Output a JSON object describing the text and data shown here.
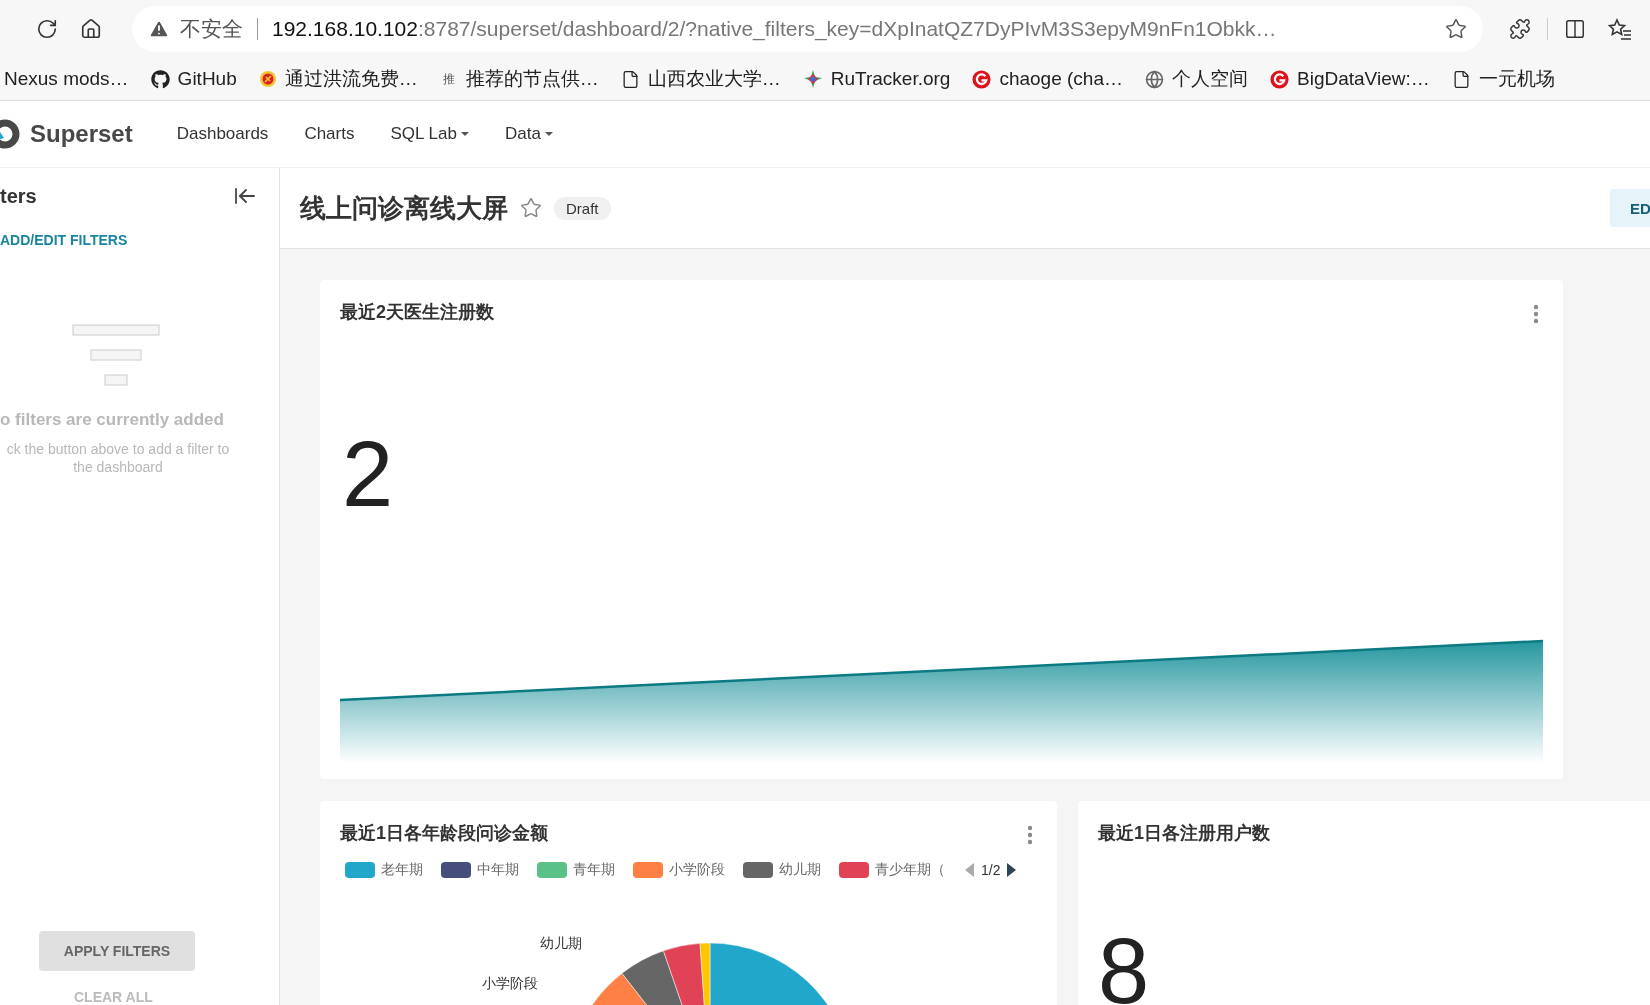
{
  "browser": {
    "security_label": "不安全",
    "url_host": "192.168.10.102",
    "url_rest": ":8787/superset/dashboard/2/?native_filters_key=dXpInatQZ7DyPIvM3S3epyM9nFn1Obkk…"
  },
  "bookmarks": [
    {
      "label": "Nexus mods…",
      "kind": "none"
    },
    {
      "label": "GitHub",
      "kind": "github"
    },
    {
      "label": "通过洪流免费…",
      "kind": "emblem"
    },
    {
      "label": "推荐的节点供…",
      "kind": "text",
      "icon_text": "推"
    },
    {
      "label": "山西农业大学…",
      "kind": "page"
    },
    {
      "label": "RuTracker.org",
      "kind": "stars"
    },
    {
      "label": "chaoge (cha…",
      "kind": "brand"
    },
    {
      "label": "个人空间",
      "kind": "globe"
    },
    {
      "label": "BigDataView:…",
      "kind": "brand"
    },
    {
      "label": "一元机场",
      "kind": "page"
    }
  ],
  "navbar": {
    "brand": "Superset",
    "items": [
      {
        "label": "Dashboards",
        "dropdown": false
      },
      {
        "label": "Charts",
        "dropdown": false
      },
      {
        "label": "SQL Lab",
        "dropdown": true
      },
      {
        "label": "Data",
        "dropdown": true
      }
    ]
  },
  "filter_bar": {
    "title": "ters",
    "add_edit": "ADD/EDIT FILTERS",
    "empty_title": "o filters are currently added",
    "empty_hint_lines": [
      "ck the button above to add a filter to",
      "the dashboard"
    ],
    "apply": "APPLY FILTERS",
    "apply_disabled": true,
    "clear": "CLEAR ALL"
  },
  "dashboard": {
    "title": "线上问诊离线大屏",
    "favorite": false,
    "status": "Draft",
    "header_button": "ED"
  },
  "charts": [
    {
      "kind": "big_number_trend",
      "title": "最近2天医生注册数",
      "value": "2",
      "menu": true
    },
    {
      "kind": "pie",
      "title": "最近1日各年龄段问诊金额",
      "menu": true,
      "legend": [
        {
          "label": "老年期",
          "color": "#20a7c9"
        },
        {
          "label": "中年期",
          "color": "#454e7c"
        },
        {
          "label": "青年期",
          "color": "#5ac189"
        },
        {
          "label": "小学阶段",
          "color": "#ff7f44"
        },
        {
          "label": "幼儿期",
          "color": "#666666"
        },
        {
          "label": "青少年期（",
          "color": "#e04355"
        }
      ],
      "legend_page": "1/2",
      "legend_prev_disabled": true,
      "legend_next_disabled": false,
      "labels": [
        "幼儿期",
        "小学阶段"
      ]
    },
    {
      "kind": "big_number",
      "title": "最近1日各注册用户数",
      "value": "8",
      "menu": false
    }
  ]
}
